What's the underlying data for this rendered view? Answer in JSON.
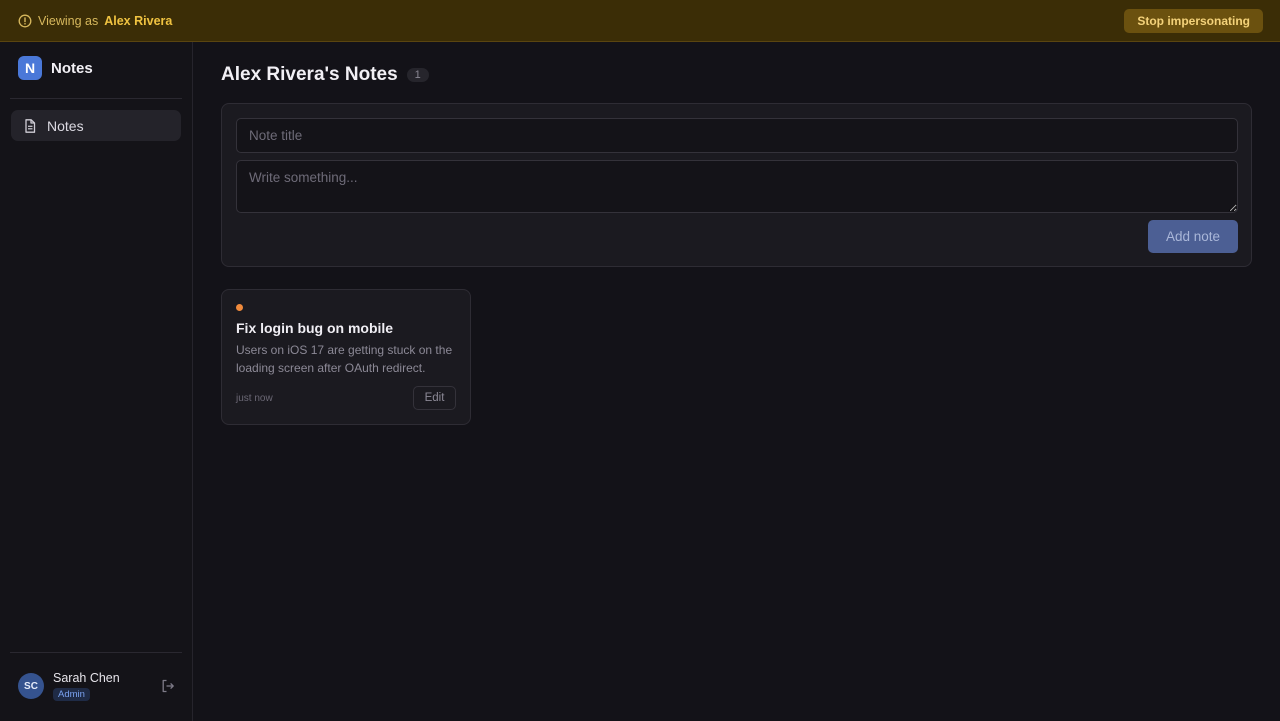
{
  "banner": {
    "prefix": "Viewing as",
    "name": "Alex Rivera",
    "stop_label": "Stop impersonating",
    "icon": "info-circle-icon"
  },
  "sidebar": {
    "brand_letter": "N",
    "brand_name": "Notes",
    "items": [
      {
        "label": "Notes",
        "icon": "document-icon",
        "active": true
      }
    ],
    "user": {
      "initials": "SC",
      "name": "Sarah Chen",
      "role": "Admin",
      "logout_icon": "logout-icon"
    }
  },
  "main": {
    "title": "Alex Rivera's Notes",
    "count": "1",
    "composer": {
      "title_placeholder": "Note title",
      "title_value": "",
      "body_placeholder": "Write something...",
      "body_value": "",
      "add_label": "Add note"
    },
    "notes": [
      {
        "title": "Fix login bug on mobile",
        "body": "Users on iOS 17 are getting stuck on the loading screen after OAuth redirect.",
        "time": "just now",
        "edit_label": "Edit",
        "dot_color": "#f08a3c"
      }
    ]
  },
  "colors": {
    "banner_bg": "#3b2d06",
    "accent": "#4a78d8",
    "warning_text": "#f0c341",
    "background": "#131218"
  }
}
